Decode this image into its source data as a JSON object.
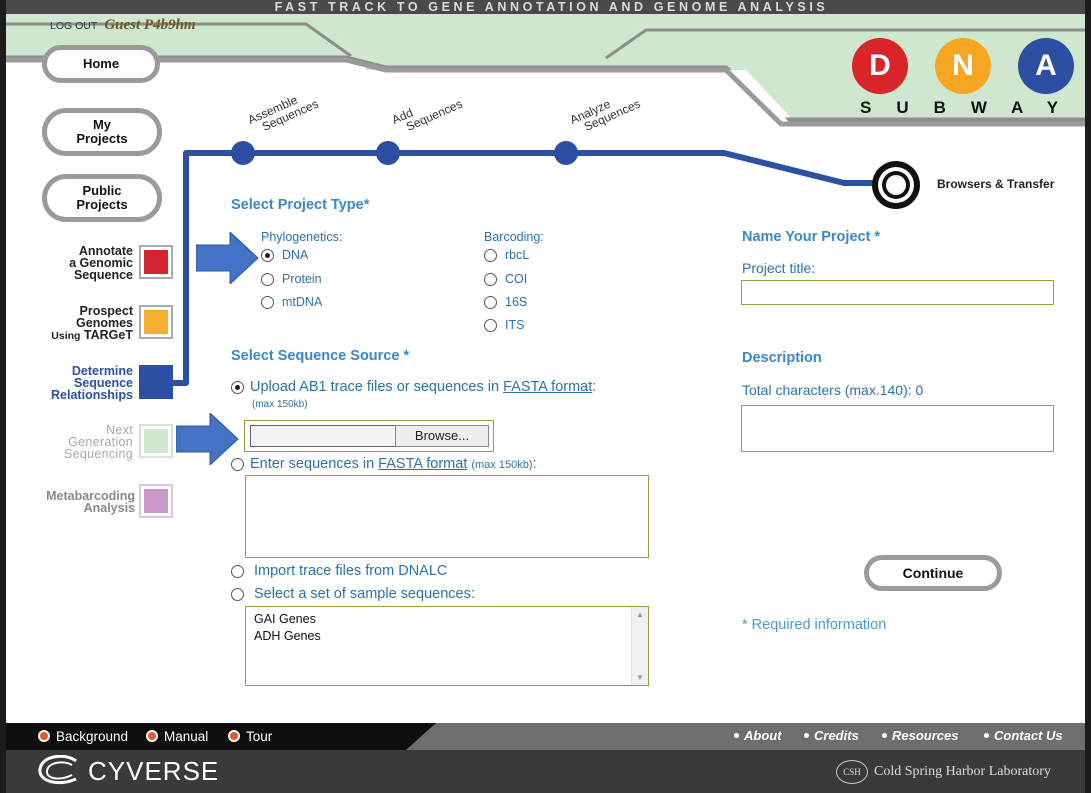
{
  "header": {
    "tagline": "FAST TRACK TO GENE ANNOTATION AND GENOME ANALYSIS",
    "logout_label": "LOG OUT",
    "user": "Guest P4b9hm",
    "logo_letters": [
      "D",
      "N",
      "A"
    ],
    "logo_word": "SUBWAY"
  },
  "nav": {
    "home": "Home",
    "my_projects": [
      "My",
      "Projects"
    ],
    "public_projects": [
      "Public",
      "Projects"
    ],
    "annotate": [
      "Annotate",
      "a Genomic",
      "Sequence"
    ],
    "prospect": [
      "Prospect",
      "Genomes"
    ],
    "prospect_sub": "Using",
    "prospect_sub_bold": "TARGeT",
    "determine": [
      "Determine",
      "Sequence",
      "Relationships"
    ],
    "ngs": [
      "Next",
      "Generation",
      "Sequencing"
    ],
    "metabarcoding": [
      "Metabarcoding",
      "Analysis"
    ]
  },
  "subway": {
    "stops": [
      {
        "label": [
          "Assemble",
          "Sequences"
        ]
      },
      {
        "label": [
          "Add",
          "Sequences"
        ]
      },
      {
        "label": [
          "Analyze",
          "Sequences"
        ]
      }
    ],
    "terminal": "Browsers & Transfer"
  },
  "form": {
    "project_type_title": "Select Project Type*",
    "phylogenetics_label": "Phylogenetics:",
    "phylo_options": [
      "DNA",
      "Protein",
      "mtDNA"
    ],
    "phylo_selected": "DNA",
    "barcoding_label": "Barcoding:",
    "barcode_options": [
      "rbcL",
      "COI",
      "16S",
      "ITS"
    ],
    "sequence_source_title": "Select Sequence Source *",
    "upload_label_pre": "Upload AB1 trace files or sequences in ",
    "fasta_link": "FASTA format",
    "upload_label_post": ":",
    "upload_max": "(max 150kb)",
    "browse_button": "Browse...",
    "enter_label_pre": "Enter sequences in ",
    "enter_max": "(max 150kb)",
    "enter_post": ":",
    "import_label": "Import trace files from DNALC",
    "sample_label": "Select a set of sample sequences:",
    "sample_options": [
      "GAI Genes",
      "ADH Genes"
    ],
    "name_title": "Name Your Project *",
    "project_title_label": "Project title:",
    "description_title": "Description",
    "description_counter": "Total characters (max.140): 0",
    "continue_button": "Continue",
    "required_note": "* Required information"
  },
  "footer": {
    "left_links": [
      "Background",
      "Manual",
      "Tour"
    ],
    "right_links": [
      "About",
      "Credits",
      "Resources",
      "Contact Us"
    ],
    "cyverse": "CYVERSE",
    "cshl_mark": "CSH",
    "cshl": "Cold Spring Harbor Laboratory"
  },
  "colors": {
    "subway_line": "#2c4ea3",
    "annotate": "#d32630",
    "prospect": "#f4b02e",
    "determine": "#2c4ea3",
    "ngs": "#cfe6cf",
    "metabarcoding": "#c99ac9",
    "logo_d": "#d9242a",
    "logo_n": "#f6a623",
    "logo_a": "#2c4ea3",
    "header_green": "#cfe6cf"
  }
}
